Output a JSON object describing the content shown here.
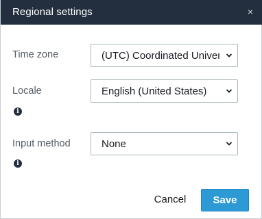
{
  "dialog": {
    "title": "Regional settings",
    "close_glyph": "×"
  },
  "fields": {
    "time_zone": {
      "label": "Time zone",
      "value": "(UTC) Coordinated Universal Time"
    },
    "locale": {
      "label": "Locale",
      "value": "English (United States)",
      "info_icon": "info-icon"
    },
    "input_method": {
      "label": "Input method",
      "value": "None",
      "info_icon": "info-icon"
    }
  },
  "footer": {
    "cancel_label": "Cancel",
    "save_label": "Save"
  },
  "colors": {
    "titlebar_bg": "#232f3e",
    "primary_button": "#2d9ad6"
  },
  "icons": {
    "close": "close-icon",
    "dropdown": "chevron-down-icon",
    "info": "info-icon"
  }
}
